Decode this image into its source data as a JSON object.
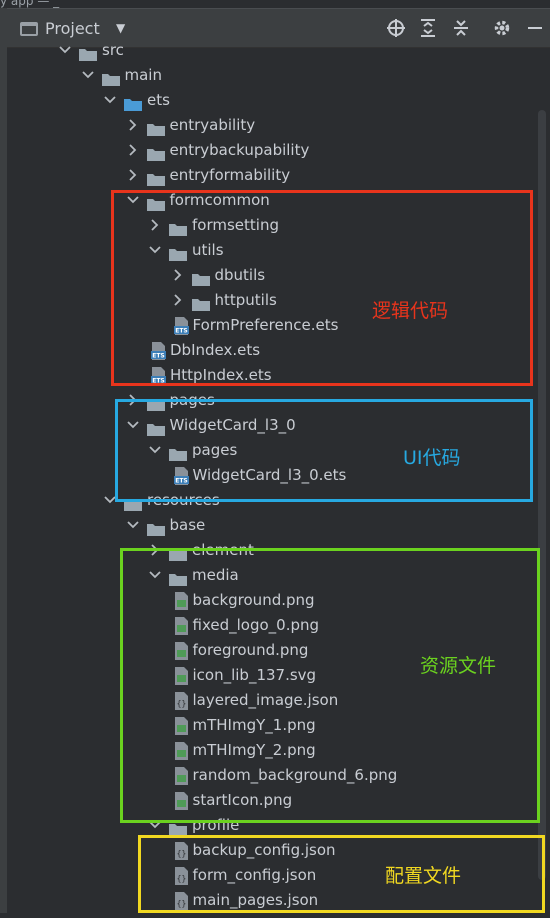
{
  "header": {
    "title": "Project",
    "window_fragment": "y app — _"
  },
  "tree": [
    {
      "label": "src",
      "kind": "folder",
      "depth": 0,
      "expanded": true,
      "row": 0
    },
    {
      "label": "main",
      "kind": "folder",
      "depth": 1,
      "expanded": true,
      "row": 1
    },
    {
      "label": "ets",
      "kind": "folder-special",
      "depth": 2,
      "expanded": true,
      "row": 2
    },
    {
      "label": "entryability",
      "kind": "folder",
      "depth": 3,
      "expanded": false,
      "row": 3
    },
    {
      "label": "entrybackupability",
      "kind": "folder",
      "depth": 3,
      "expanded": false,
      "row": 4
    },
    {
      "label": "entryformability",
      "kind": "folder",
      "depth": 3,
      "expanded": false,
      "row": 5
    },
    {
      "label": "formcommon",
      "kind": "folder",
      "depth": 3,
      "expanded": true,
      "row": 6
    },
    {
      "label": "formsetting",
      "kind": "folder",
      "depth": 4,
      "expanded": false,
      "row": 7
    },
    {
      "label": "utils",
      "kind": "folder",
      "depth": 4,
      "expanded": true,
      "row": 8
    },
    {
      "label": "dbutils",
      "kind": "folder",
      "depth": 5,
      "expanded": false,
      "row": 9
    },
    {
      "label": "httputils",
      "kind": "folder",
      "depth": 5,
      "expanded": false,
      "row": 10
    },
    {
      "label": "FormPreference.ets",
      "kind": "ets",
      "depth": 5,
      "row": 11
    },
    {
      "label": "DbIndex.ets",
      "kind": "ets",
      "depth": 4,
      "row": 12
    },
    {
      "label": "HttpIndex.ets",
      "kind": "ets",
      "depth": 4,
      "row": 13
    },
    {
      "label": "pages",
      "kind": "folder",
      "depth": 3,
      "expanded": false,
      "row": 14
    },
    {
      "label": "WidgetCard_l3_0",
      "kind": "folder",
      "depth": 3,
      "expanded": true,
      "row": 15
    },
    {
      "label": "pages",
      "kind": "folder",
      "depth": 4,
      "expanded": true,
      "row": 16
    },
    {
      "label": "WidgetCard_l3_0.ets",
      "kind": "ets",
      "depth": 5,
      "row": 17
    },
    {
      "label": "resources",
      "kind": "folder",
      "depth": 2,
      "expanded": true,
      "row": 18
    },
    {
      "label": "base",
      "kind": "folder",
      "depth": 3,
      "expanded": true,
      "row": 19
    },
    {
      "label": "element",
      "kind": "folder",
      "depth": 4,
      "expanded": false,
      "row": 20
    },
    {
      "label": "media",
      "kind": "folder",
      "depth": 4,
      "expanded": true,
      "row": 21
    },
    {
      "label": "background.png",
      "kind": "image",
      "depth": 5,
      "row": 22
    },
    {
      "label": "fixed_logo_0.png",
      "kind": "image",
      "depth": 5,
      "row": 23
    },
    {
      "label": "foreground.png",
      "kind": "image",
      "depth": 5,
      "row": 24
    },
    {
      "label": "icon_lib_137.svg",
      "kind": "image",
      "depth": 5,
      "row": 25
    },
    {
      "label": "layered_image.json",
      "kind": "json",
      "depth": 5,
      "row": 26
    },
    {
      "label": "mTHImgY_1.png",
      "kind": "image",
      "depth": 5,
      "row": 27
    },
    {
      "label": "mTHImgY_2.png",
      "kind": "image",
      "depth": 5,
      "row": 28
    },
    {
      "label": "random_background_6.png",
      "kind": "image",
      "depth": 5,
      "row": 29
    },
    {
      "label": "startIcon.png",
      "kind": "image",
      "depth": 5,
      "row": 30
    },
    {
      "label": "profile",
      "kind": "folder",
      "depth": 4,
      "expanded": true,
      "row": 31
    },
    {
      "label": "backup_config.json",
      "kind": "json",
      "depth": 5,
      "row": 32
    },
    {
      "label": "form_config.json",
      "kind": "json",
      "depth": 5,
      "row": 33
    },
    {
      "label": "main_pages.json",
      "kind": "json",
      "depth": 5,
      "row": 34
    }
  ],
  "annotations": {
    "logic": "逻辑代码",
    "ui": "UI代码",
    "resources": "资源文件",
    "config": "配置文件"
  },
  "colors": {
    "logic": "#e8341c",
    "ui": "#27a9e1",
    "resources": "#6bd21f",
    "config": "#f1d821",
    "folder": "#9aa7b0",
    "folder_special": "#4a9bd6"
  }
}
